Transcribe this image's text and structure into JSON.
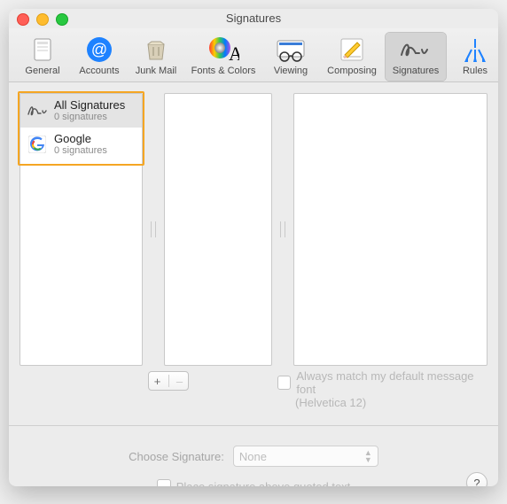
{
  "window": {
    "title": "Signatures"
  },
  "toolbar": {
    "items": [
      {
        "label": "General"
      },
      {
        "label": "Accounts"
      },
      {
        "label": "Junk Mail"
      },
      {
        "label": "Fonts & Colors"
      },
      {
        "label": "Viewing"
      },
      {
        "label": "Composing"
      },
      {
        "label": "Signatures"
      },
      {
        "label": "Rules"
      }
    ]
  },
  "accounts": {
    "items": [
      {
        "title": "All Signatures",
        "subtitle": "0 signatures"
      },
      {
        "title": "Google",
        "subtitle": "0 signatures"
      }
    ]
  },
  "buttons": {
    "plus": "+",
    "minus": "–"
  },
  "checkbox1": {
    "label": "Always match my default message font",
    "sub": "(Helvetica 12)"
  },
  "choose": {
    "label": "Choose Signature:",
    "value": "None"
  },
  "checkbox2": {
    "label": "Place signature above quoted text"
  },
  "help": {
    "label": "?"
  }
}
